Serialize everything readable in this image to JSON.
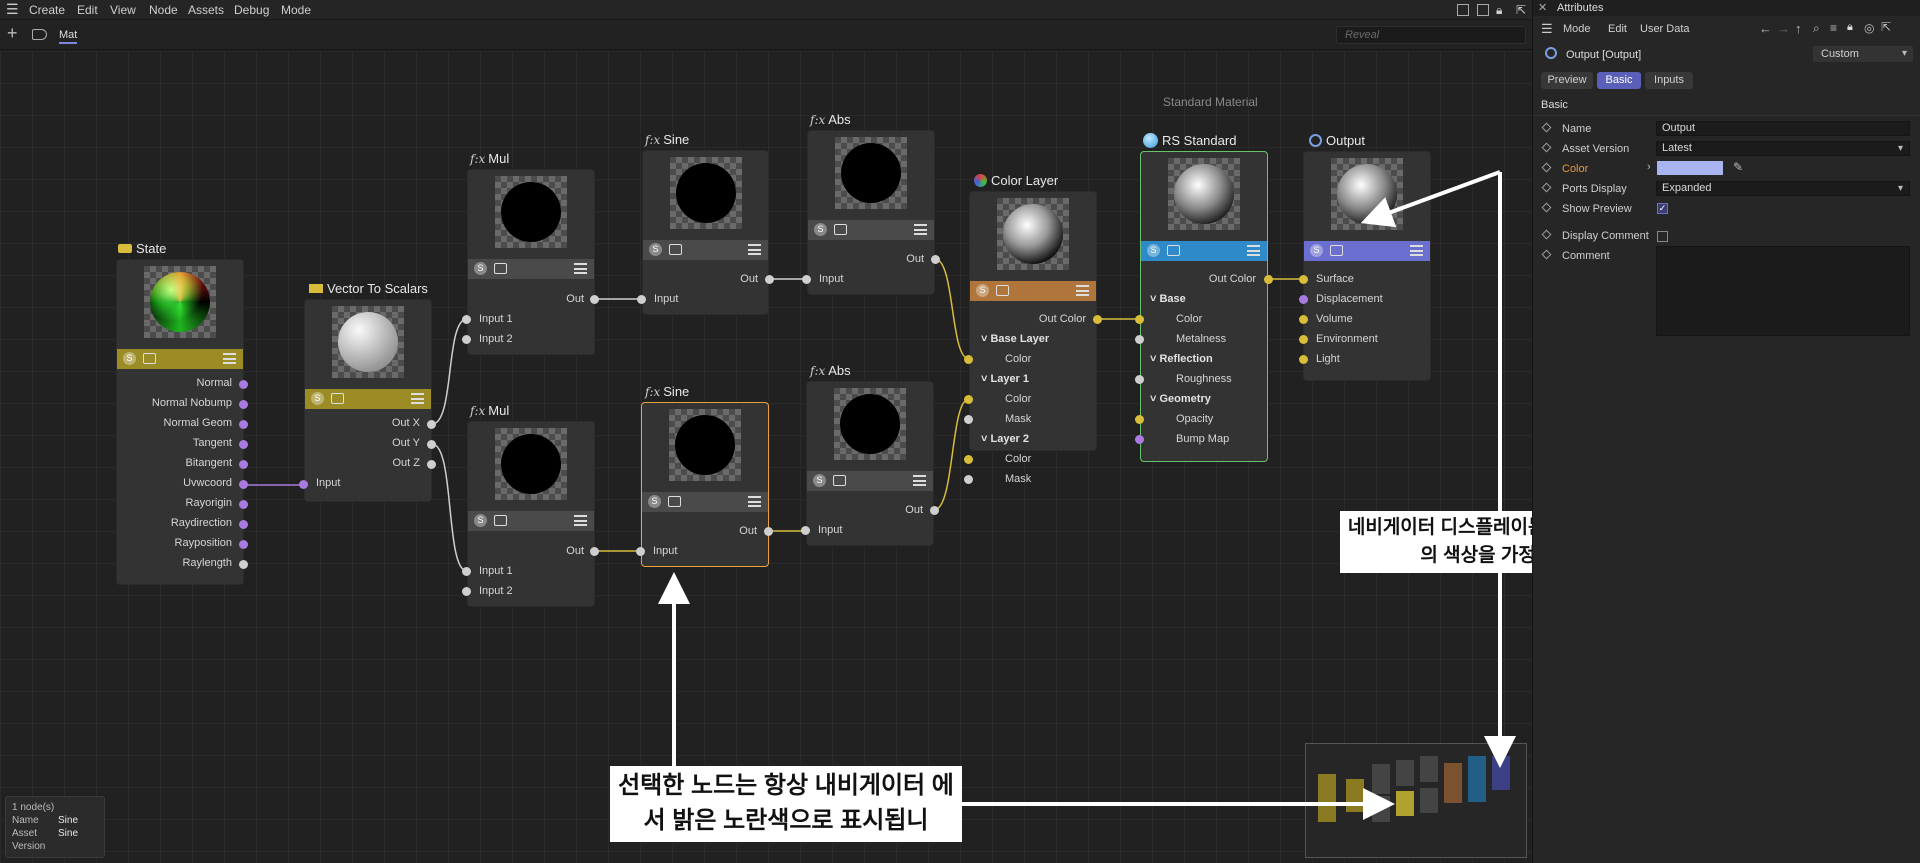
{
  "menu": {
    "items": [
      "Create",
      "Edit",
      "View",
      "Node",
      "Assets",
      "Debug",
      "Mode"
    ]
  },
  "tab": {
    "label": "Mat"
  },
  "reveal_placeholder": "Reveal",
  "nodes": {
    "state": {
      "title": "State",
      "ports": [
        "Normal",
        "Normal Nobump",
        "Normal Geom",
        "Tangent",
        "Bitangent",
        "Uvwcoord",
        "Rayorigin",
        "Raydirection",
        "Rayposition",
        "Raylength"
      ]
    },
    "vts": {
      "title": "Vector To Scalars",
      "outs": [
        "Out X",
        "Out Y",
        "Out Z"
      ],
      "in": "Input"
    },
    "mul1": {
      "title": "Mul",
      "fx": "f:x",
      "out": "Out",
      "ins": [
        "Input 1",
        "Input 2"
      ]
    },
    "mul2": {
      "title": "Mul",
      "fx": "f:x",
      "out": "Out",
      "ins": [
        "Input 1",
        "Input 2"
      ]
    },
    "sine1": {
      "title": "Sine",
      "fx": "f:x",
      "out": "Out",
      "in": "Input"
    },
    "sine2": {
      "title": "Sine",
      "fx": "f:x",
      "out": "Out",
      "in": "Input"
    },
    "abs1": {
      "title": "Abs",
      "fx": "f:x",
      "out": "Out",
      "in": "Input"
    },
    "abs2": {
      "title": "Abs",
      "fx": "f:x",
      "out": "Out",
      "in": "Input"
    },
    "colorlayer": {
      "title": "Color Layer",
      "out": "Out Color",
      "ports": [
        "Base Layer",
        "Color",
        "Layer 1",
        "Color",
        "Mask",
        "Layer 2",
        "Color",
        "Mask"
      ]
    },
    "rs": {
      "subtitle": "Standard Material",
      "title": "RS Standard",
      "out": "Out Color",
      "ports": [
        "Base",
        "Color",
        "Metalness",
        "Reflection",
        "Roughness",
        "Geometry",
        "Opacity",
        "Bump Map"
      ]
    },
    "output": {
      "title": "Output",
      "ports": [
        "Surface",
        "Displacement",
        "Volume",
        "Environment",
        "Light"
      ]
    }
  },
  "info": {
    "count": "1 node(s)",
    "name_label": "Name",
    "name_value": "Sine",
    "asset_label": "Asset",
    "asset_value": "Sine",
    "version_label": "Version"
  },
  "annotations": {
    "a1": "네비게이터 디스플레이는 노드 기본 설정의 색상을 가정합니다.",
    "a2": "선택한 노드는 항상 내비게이터 에서 밝은 노란색으로 표시됩니"
  },
  "side": {
    "title": "Attributes",
    "menu": [
      "Mode",
      "Edit",
      "User Data"
    ],
    "object": "Output [Output]",
    "preset": "Custom",
    "tabs": [
      "Preview",
      "Basic",
      "Inputs"
    ],
    "section": "Basic",
    "rows": {
      "name": "Name",
      "asset_version": "Asset Version",
      "color": "Color",
      "ports_display": "Ports Display",
      "show_preview": "Show Preview",
      "display_comment": "Display Comment",
      "comment": "Comment"
    },
    "values": {
      "name": "Output",
      "asset_version": "Latest",
      "ports_display": "Expanded"
    },
    "color_swatch": "#a8b4f0"
  },
  "colors": {
    "yellow_bar": "#9c8c25",
    "orange_bar": "#b0753a",
    "blue_bar": "#2e8ac8",
    "purple_bar": "#6a6fd0",
    "gray_bar": "#4a4a4a",
    "selected": "#e8a33c"
  }
}
